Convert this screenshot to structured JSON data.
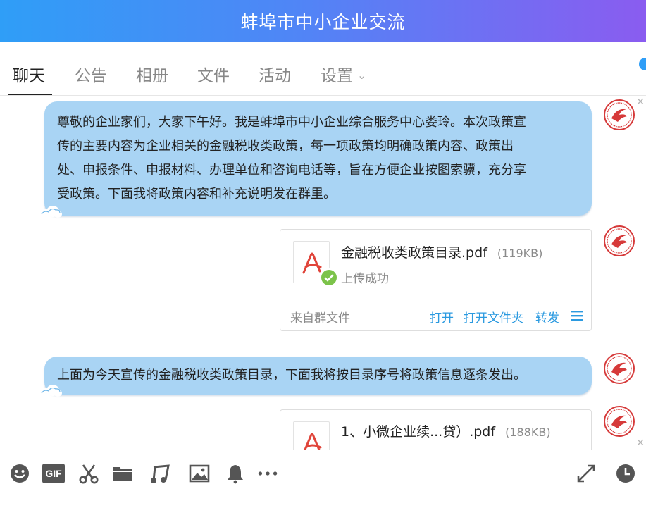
{
  "header": {
    "title": "蚌埠市中小企业交流"
  },
  "tabs": [
    {
      "label": "聊天"
    },
    {
      "label": "公告"
    },
    {
      "label": "相册"
    },
    {
      "label": "文件"
    },
    {
      "label": "活动"
    },
    {
      "label": "设置"
    }
  ],
  "messages": [
    {
      "type": "text",
      "lines": [
        "尊敬的企业家们，大家下午好。我是蚌埠市中小企业综合服务中心娄玲。本次政策宣",
        "传的主要内容为企业相关的金融税收类政策，每一项政策均明确政策内容、政策出",
        "处、申报条件、申报材料、办理单位和咨询电话等，旨在方便企业按图索骥，充分享",
        "受政策。下面我将政策内容和补充说明发在群里。"
      ]
    },
    {
      "type": "file",
      "name": "金融税收类政策目录.pdf",
      "size": "(119KB)",
      "status": "上传成功",
      "source": "来自群文件",
      "actions": [
        "打开",
        "打开文件夹",
        "转发"
      ]
    },
    {
      "type": "text",
      "lines": [
        "上面为今天宣传的金融税收类政策目录，下面我将按目录序号将政策信息逐条发出。"
      ]
    },
    {
      "type": "file",
      "name": "1、小微企业续...贷）.pdf",
      "size": "(188KB)"
    }
  ],
  "toolbar": {
    "icons": [
      "emoji-icon",
      "gif-icon",
      "scissors-icon",
      "folder-icon",
      "music-icon",
      "image-icon",
      "bell-icon",
      "more-icon",
      "expand-icon",
      "history-icon"
    ],
    "gif_label": "GIF"
  },
  "colors": {
    "header_gradient_start": "#2f9ef7",
    "header_gradient_end": "#8a5cf0",
    "bubble": "#a9d4f4",
    "link": "#2b9ae0",
    "avatar_red": "#d63a3a",
    "success_green": "#7cc34a",
    "pdf_red": "#e0443a"
  }
}
